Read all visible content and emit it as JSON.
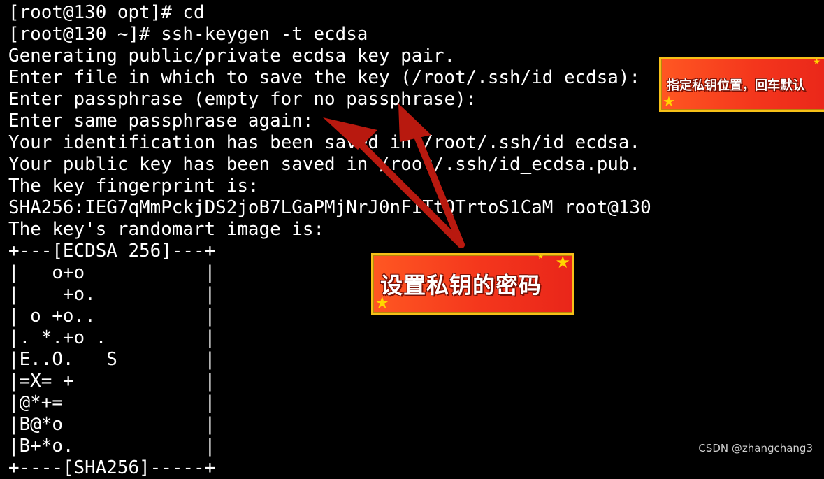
{
  "terminal": {
    "lines": [
      "[root@130 opt]# cd",
      "[root@130 ~]# ssh-keygen -t ecdsa",
      "Generating public/private ecdsa key pair.",
      "Enter file in which to save the key (/root/.ssh/id_ecdsa):",
      "Enter passphrase (empty for no passphrase):",
      "Enter same passphrase again:",
      "Your identification has been saved in /root/.ssh/id_ecdsa.",
      "Your public key has been saved in /root/.ssh/id_ecdsa.pub.",
      "The key fingerprint is:",
      "SHA256:IEG7qMmPckjDS2joB7LGaPMjNrJ0nFITtQTrtoS1CaM root@130",
      "The key's randomart image is:",
      "+---[ECDSA 256]---+",
      "|   o+o           |",
      "|    +o.          |",
      "| o +o..          |",
      "|. *.+o .         |",
      "|E..O.   S        |",
      "|=X= +            |",
      "|@*+=             |",
      "|B@*o             |",
      "|B+*o.            |",
      "+----[SHA256]-----+"
    ]
  },
  "annotations": {
    "top_callout": "指定私钥位置，回车默认",
    "middle_callout": "设置私钥的密码"
  },
  "watermark": "CSDN @zhangchang3",
  "colors": {
    "background": "#000000",
    "text": "#ffffff",
    "arrow": "#b8190f",
    "callout_fill": "#f4361c",
    "callout_border": "#f6c018"
  }
}
